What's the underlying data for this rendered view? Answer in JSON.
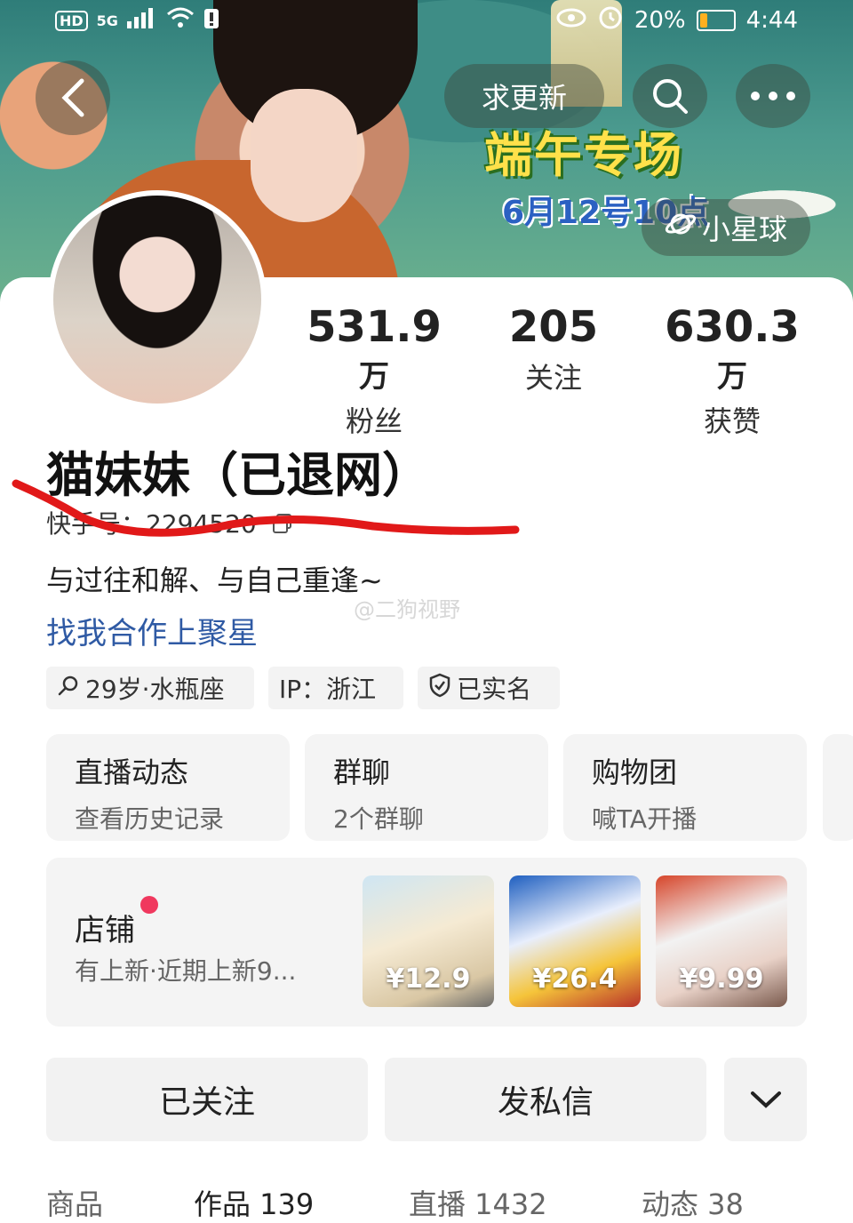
{
  "status_bar": {
    "hd": "HD",
    "network": "5G",
    "battery_pct": "20%",
    "time": "4:44"
  },
  "header": {
    "request_update": "求更新",
    "banner_title": "端午专场",
    "banner_date": "6月12号10点",
    "planet_label": "小星球"
  },
  "profile": {
    "fans_value": "531.9",
    "fans_unit": "万",
    "fans_label": "粉丝",
    "following_value": "205",
    "following_label": "关注",
    "likes_value": "630.3",
    "likes_unit": "万",
    "likes_label": "获赞",
    "name": "猫妹妹（已退网）",
    "kuaishou_id": "快手号：2294520",
    "bio": "与过往和解、与自己重逢~",
    "cooperation_link": "找我合作上聚星",
    "watermark": "@二狗视野"
  },
  "tags": [
    "29岁·水瓶座",
    "IP：浙江",
    "已实名"
  ],
  "quick_cards": [
    {
      "title": "直播动态",
      "sub": "查看历史记录"
    },
    {
      "title": "群聊",
      "sub": "2个群聊"
    },
    {
      "title": "购物团",
      "sub": "喊TA开播"
    }
  ],
  "shop": {
    "title": "店铺",
    "subtitle": "有上新·近期上新9...",
    "products": [
      {
        "price": "¥12.9"
      },
      {
        "price": "¥26.4"
      },
      {
        "price": "¥9.99"
      }
    ]
  },
  "actions": {
    "followed": "已关注",
    "message": "发私信"
  },
  "tabs": [
    "商品",
    "作品 139",
    "直播 1432",
    "动态 38"
  ]
}
